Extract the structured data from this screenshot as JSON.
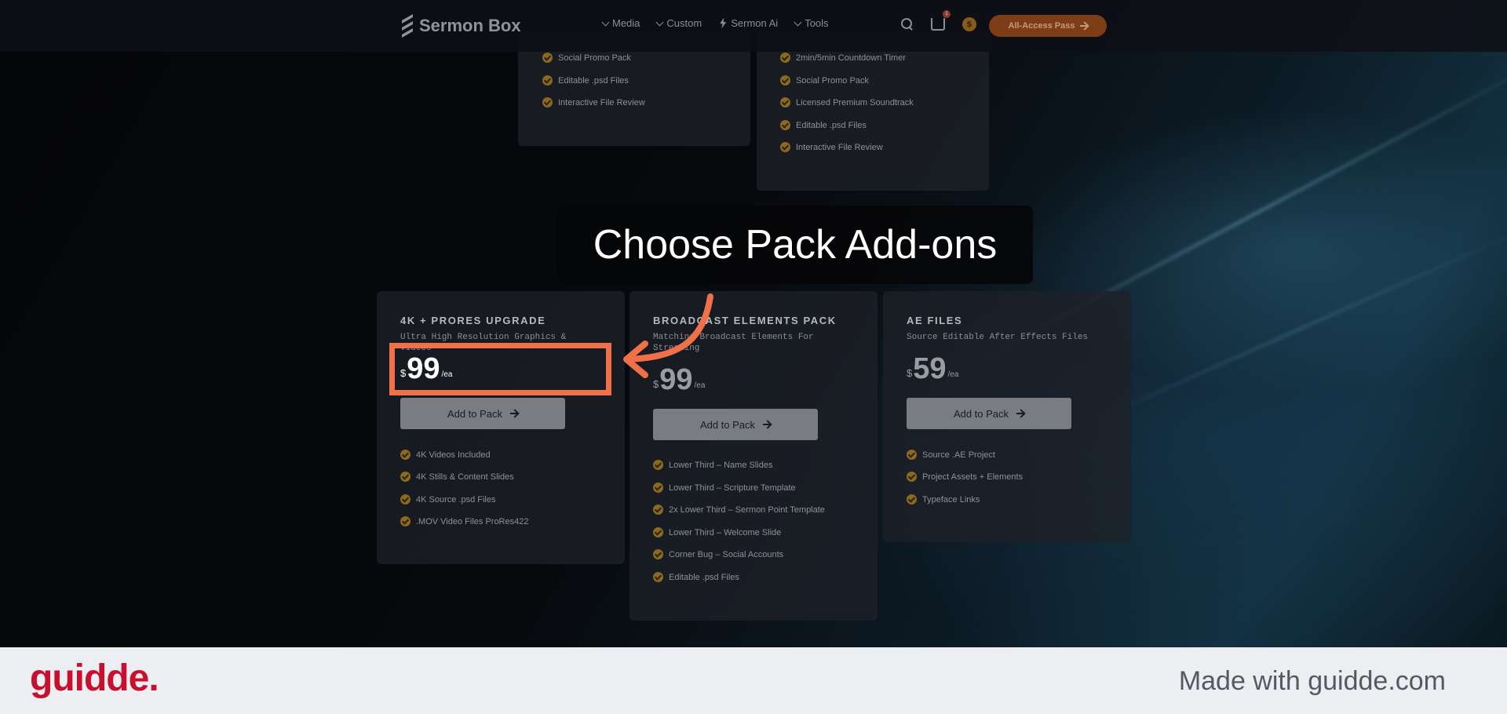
{
  "header": {
    "logo_text": "Sermon Box",
    "nav": [
      {
        "label": "Media",
        "icon": "chevron-down-icon"
      },
      {
        "label": "Custom",
        "icon": "chevron-down-icon"
      },
      {
        "label": "Sermon Ai",
        "icon": "bolt-icon"
      },
      {
        "label": "Tools",
        "icon": "chevron-down-icon"
      }
    ],
    "cart_count": "1",
    "coin_symbol": "$",
    "pass_button": "All-Access Pass"
  },
  "top_cards": {
    "left_features": [
      "Social Promo Pack",
      "Editable .psd Files",
      "Interactive File Review"
    ],
    "right_features": [
      "2min/5min Countdown Timer",
      "Social Promo Pack",
      "Licensed Premium Soundtrack",
      "Editable .psd Files",
      "Interactive File Review"
    ]
  },
  "overlay_title": "Choose Pack Add-ons",
  "addons": [
    {
      "name": "4K + PRORES UPGRADE",
      "subtitle": "Ultra High Resolution Graphics & Videos",
      "currency": "$",
      "price": "99",
      "per": "/ea",
      "button": "Add to Pack",
      "features": [
        "4K Videos Included",
        "4K Stills & Content Slides",
        "4K Source .psd Files",
        ".MOV Video Files ProRes422"
      ]
    },
    {
      "name": "BROADCAST ELEMENTS PACK",
      "subtitle": "Matching Broadcast Elements For Streaming",
      "currency": "$",
      "price": "99",
      "per": "/ea",
      "button": "Add to Pack",
      "features": [
        "Lower Third – Name Slides",
        "Lower Third – Scripture Template",
        "2x Lower Third – Sermon Point Template",
        "Lower Third – Welcome Slide",
        "Corner Bug – Social Accounts",
        "Editable .psd Files"
      ]
    },
    {
      "name": "AE FILES",
      "subtitle": "Source Editable After Effects Files",
      "currency": "$",
      "price": "59",
      "per": "/ea",
      "button": "Add to Pack",
      "features": [
        "Source .AE Project",
        "Project Assets + Elements",
        "Typeface Links"
      ]
    }
  ],
  "colors": {
    "highlight": "#f0704a",
    "accent_orange": "#7c3d17",
    "check": "#8b6a1e",
    "brand_red": "#c8102e"
  },
  "footer": {
    "brand": "guidde.",
    "made_with": "Made with guidde.com"
  }
}
